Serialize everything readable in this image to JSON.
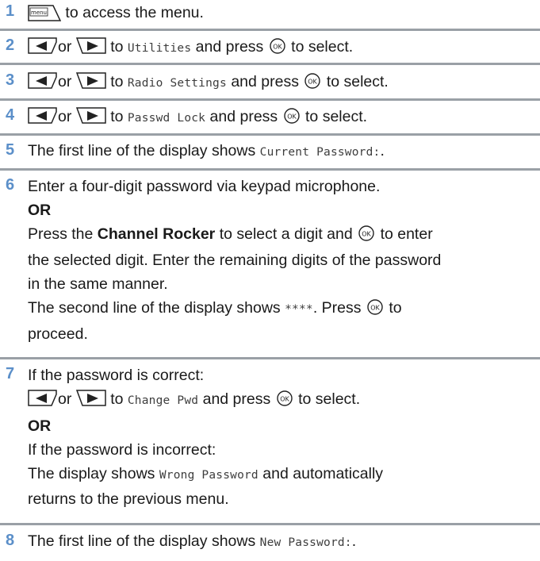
{
  "steps": [
    {
      "num": "1",
      "menu_label": "menu",
      "text": "to access the menu."
    },
    {
      "num": "2",
      "or": "or",
      "to": "to",
      "target": "Utilities",
      "press": "and press",
      "select": "to select."
    },
    {
      "num": "3",
      "or": "or",
      "to": "to",
      "target": "Radio Settings",
      "press": "and press",
      "select": "to select."
    },
    {
      "num": "4",
      "or": "or",
      "to": "to",
      "target": "Passwd Lock",
      "press": "and press",
      "select": "to select."
    },
    {
      "num": "5",
      "text": "The first line of the display shows",
      "display": "Current Password:",
      "end": "."
    },
    {
      "num": "6",
      "line1": "Enter a four-digit password via keypad microphone.",
      "or_label": "OR",
      "press": "Press the",
      "rocker": "Channel Rocker",
      "line3b": "to select a digit and",
      "line3c": "to enter",
      "line4": "the selected digit. Enter the remaining digits of the password",
      "line5": "in the same manner.",
      "line6a": "The second line of the display shows",
      "stars": "****",
      "line6b": ". Press",
      "line6c": "to",
      "line7": "proceed."
    },
    {
      "num": "7",
      "line1": "If the password is correct:",
      "or": "or",
      "to": "to",
      "target": "Change Pwd",
      "press": "and press",
      "select": "to select.",
      "or_label": "OR",
      "line4": "If the password is incorrect:",
      "line5a": "The display shows",
      "wrong": "Wrong Password",
      "line5b": "and automatically",
      "line6": "returns to the previous menu."
    },
    {
      "num": "8",
      "text": "The first line of the display shows",
      "display": "New Password:",
      "end": "."
    }
  ],
  "icons": {
    "ok": "ok-button-icon",
    "left": "left-arrow-button-icon",
    "right": "right-arrow-button-icon",
    "menu": "menu-button-icon"
  },
  "colors": {
    "step_number": "#5b8fc9",
    "rule": "#9aa0a6"
  }
}
